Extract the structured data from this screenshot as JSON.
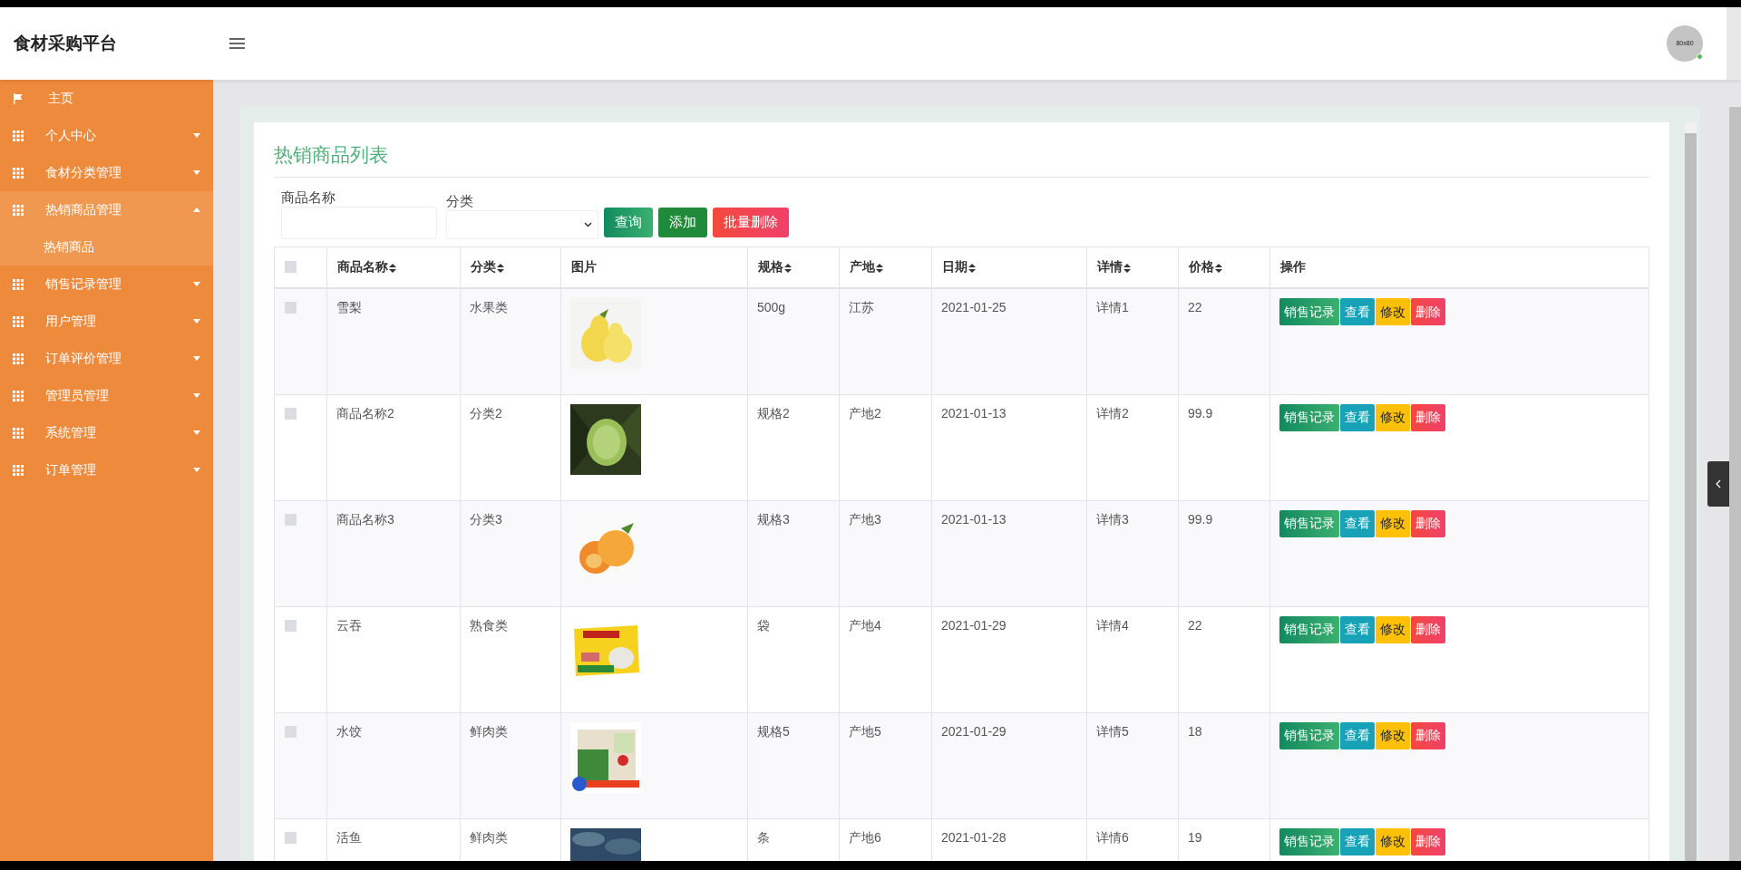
{
  "header": {
    "title": "食材采购平台",
    "avatar": {
      "label": "80x80",
      "online": true
    }
  },
  "sidebar": {
    "items": [
      {
        "label": "主页",
        "kind": "link",
        "expanded": false
      },
      {
        "label": "个人中心",
        "kind": "menu",
        "expanded": false
      },
      {
        "label": "食材分类管理",
        "kind": "menu",
        "expanded": false
      },
      {
        "label": "热销商品管理",
        "kind": "menu",
        "expanded": true,
        "children": [
          {
            "label": "热销商品",
            "selected": true
          }
        ]
      },
      {
        "label": "销售记录管理",
        "kind": "menu",
        "expanded": false
      },
      {
        "label": "用户管理",
        "kind": "menu",
        "expanded": false
      },
      {
        "label": "订单评价管理",
        "kind": "menu",
        "expanded": false
      },
      {
        "label": "管理员管理",
        "kind": "menu",
        "expanded": false
      },
      {
        "label": "系统管理",
        "kind": "menu",
        "expanded": false
      },
      {
        "label": "订单管理",
        "kind": "menu",
        "expanded": false
      }
    ]
  },
  "panel": {
    "title": "热销商品列表",
    "filters": [
      {
        "label": "商品名称",
        "kind": "text"
      },
      {
        "label": "分类",
        "kind": "select"
      }
    ],
    "buttons": [
      {
        "label": "查询",
        "kind": "query"
      },
      {
        "label": "添加",
        "kind": "add"
      },
      {
        "label": "批量删除",
        "kind": "batch_delete"
      }
    ],
    "table": {
      "select_all": {
        "checked": false
      },
      "columns": [
        {
          "label": "商品名称",
          "sortable": true,
          "kind": "text"
        },
        {
          "label": "分类",
          "sortable": true,
          "kind": "text"
        },
        {
          "label": "图片",
          "sortable": false,
          "kind": "picture"
        },
        {
          "label": "规格",
          "sortable": true,
          "kind": "text"
        },
        {
          "label": "产地",
          "sortable": true,
          "kind": "text"
        },
        {
          "label": "日期",
          "sortable": true,
          "kind": "text"
        },
        {
          "label": "详情",
          "sortable": true,
          "kind": "text"
        },
        {
          "label": "价格",
          "sortable": true,
          "kind": "text"
        },
        {
          "label": "操作",
          "sortable": false,
          "kind": "actions"
        }
      ],
      "rows": [
        {
          "checked": false,
          "cells": [
            "雪梨",
            "水果类",
            "",
            "500g",
            "江苏",
            "2021-01-25",
            "详情1",
            "22"
          ],
          "actions": [
            {
              "label": "销售记录",
              "kind": "records"
            },
            {
              "label": "查看",
              "kind": "view"
            },
            {
              "label": "修改",
              "kind": "edit"
            },
            {
              "label": "删除",
              "kind": "delete"
            }
          ]
        },
        {
          "checked": false,
          "cells": [
            "商品名称2",
            "分类2",
            "",
            "规格2",
            "产地2",
            "2021-01-13",
            "详情2",
            "99.9"
          ],
          "actions": [
            {
              "label": "销售记录",
              "kind": "records"
            },
            {
              "label": "查看",
              "kind": "view"
            },
            {
              "label": "修改",
              "kind": "edit"
            },
            {
              "label": "删除",
              "kind": "delete"
            }
          ]
        },
        {
          "checked": false,
          "cells": [
            "商品名称3",
            "分类3",
            "",
            "规格3",
            "产地3",
            "2021-01-13",
            "详情3",
            "99.9"
          ],
          "actions": [
            {
              "label": "销售记录",
              "kind": "records"
            },
            {
              "label": "查看",
              "kind": "view"
            },
            {
              "label": "修改",
              "kind": "edit"
            },
            {
              "label": "删除",
              "kind": "delete"
            }
          ]
        },
        {
          "checked": false,
          "cells": [
            "云吞",
            "熟食类",
            "",
            "袋",
            "产地4",
            "2021-01-29",
            "详情4",
            "22"
          ],
          "actions": [
            {
              "label": "销售记录",
              "kind": "records"
            },
            {
              "label": "查看",
              "kind": "view"
            },
            {
              "label": "修改",
              "kind": "edit"
            },
            {
              "label": "删除",
              "kind": "delete"
            }
          ]
        },
        {
          "checked": false,
          "cells": [
            "水饺",
            "鲜肉类",
            "",
            "规格5",
            "产地5",
            "2021-01-29",
            "详情5",
            "18"
          ],
          "actions": [
            {
              "label": "销售记录",
              "kind": "records"
            },
            {
              "label": "查看",
              "kind": "view"
            },
            {
              "label": "修改",
              "kind": "edit"
            },
            {
              "label": "删除",
              "kind": "delete"
            }
          ]
        },
        {
          "checked": false,
          "cells": [
            "活鱼",
            "鲜肉类",
            "",
            "条",
            "产地6",
            "2021-01-28",
            "详情6",
            "19"
          ],
          "actions": [
            {
              "label": "销售记录",
              "kind": "records"
            },
            {
              "label": "查看",
              "kind": "view"
            },
            {
              "label": "修改",
              "kind": "edit"
            },
            {
              "label": "删除",
              "kind": "delete"
            }
          ]
        }
      ]
    }
  }
}
